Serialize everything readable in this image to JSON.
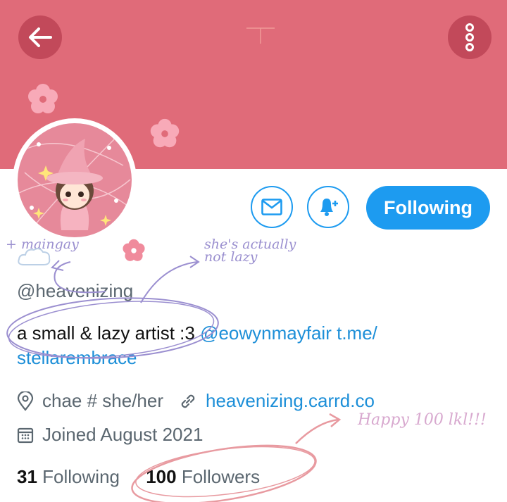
{
  "header": {
    "back_icon": "arrow-left-icon",
    "more_icon": "vertical-dots-icon",
    "banner_color": "#e06b79"
  },
  "actions": {
    "message_icon": "envelope-icon",
    "notify_icon": "bell-plus-icon",
    "following_label": "Following",
    "accent_color": "#1d9bf0"
  },
  "profile": {
    "handle": "@heavenizing",
    "bio_text": "a small & lazy artist :3 ",
    "bio_mention": "@eowynmayfair",
    "bio_link_part1": " t.me/",
    "bio_link_part2": "stellarembrace",
    "location": "chae # she/her",
    "website": "heavenizing.carrd.co",
    "joined": "Joined August 2021",
    "following_count": "31",
    "following_label": "Following",
    "followers_count": "100",
    "followers_label": "Followers"
  },
  "annotations": {
    "note_left": "+ maingay",
    "note_right_line1": "she's actually",
    "note_right_line2": "not lazy",
    "note_happy": "Happy 100 lkl!!!"
  }
}
